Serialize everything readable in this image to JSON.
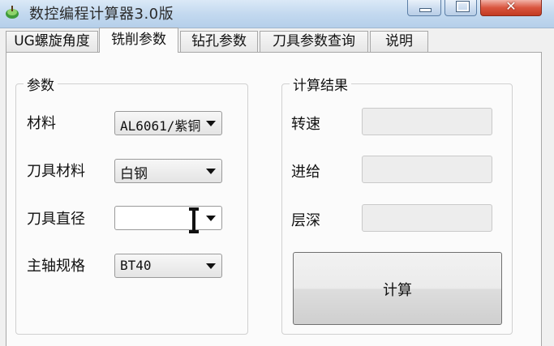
{
  "window": {
    "title": "数控编程计算器3.0版",
    "close_glyph": "✕"
  },
  "tabs": [
    {
      "label": "UG螺旋角度",
      "active": false
    },
    {
      "label": "铣削参数",
      "active": true
    },
    {
      "label": "钻孔参数",
      "active": false
    },
    {
      "label": "刀具参数查询",
      "active": false
    },
    {
      "label": "说明",
      "active": false
    }
  ],
  "params_group": {
    "title": "参数",
    "material": {
      "label": "材料",
      "value": "AL6061/紫铜"
    },
    "tool_material": {
      "label": "刀具材料",
      "value": "白钢"
    },
    "tool_diameter": {
      "label": "刀具直径",
      "value": ""
    },
    "spindle": {
      "label": "主轴规格",
      "value": "BT40"
    }
  },
  "results_group": {
    "title": "计算结果",
    "speed": {
      "label": "转速",
      "value": ""
    },
    "feed": {
      "label": "进给",
      "value": ""
    },
    "depth": {
      "label": "层深",
      "value": ""
    },
    "calculate_label": "计算"
  },
  "icons": {
    "app": "app-icon",
    "minimize": "minimize-icon",
    "maximize": "maximize-icon",
    "close": "close-icon",
    "dropdown": "chevron-down-icon",
    "cursor": "text-cursor-icon"
  },
  "colors": {
    "titlebar": "#c3d9ef",
    "close_button": "#c23b22",
    "panel": "#fbfbfb"
  }
}
